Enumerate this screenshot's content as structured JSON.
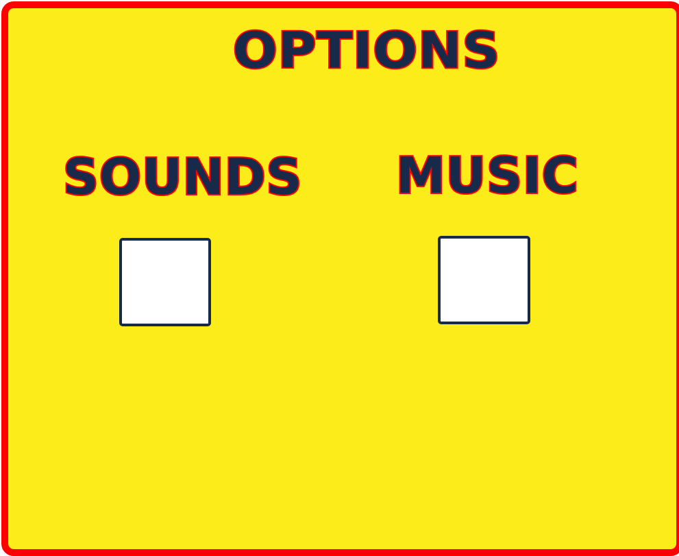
{
  "options_panel": {
    "title": "OPTIONS",
    "sounds": {
      "label": "SOUNDS",
      "checked": false
    },
    "music": {
      "label": "MUSIC",
      "checked": false
    }
  },
  "colors": {
    "panel_background": "#fcec1a",
    "panel_border": "#ff0000",
    "text_fill": "#172a4a",
    "text_outline": "#ff0000",
    "checkbox_fill": "#ffffff",
    "checkbox_border": "#172a4a"
  }
}
